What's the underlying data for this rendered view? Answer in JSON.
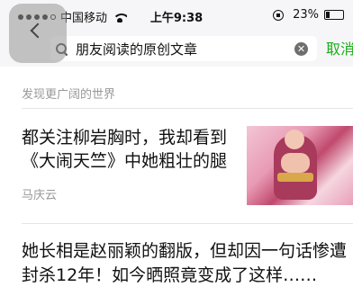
{
  "status_bar": {
    "carrier": "中国移动",
    "time": "上午9:38",
    "battery_percent": "23%",
    "battery_level": 0.23,
    "signal_bars": 4
  },
  "search": {
    "query": "朋友阅读的原创文章",
    "cancel_label": "取消"
  },
  "section": {
    "label": "发现更广阔的世界"
  },
  "articles": [
    {
      "title_lines": [
        "都关注柳岩胸时，我却看到",
        "《大闹天竺》中她粗壮的腿"
      ],
      "source": "马庆云",
      "thumbnail": "thumbnail-image"
    },
    {
      "title_lines": [
        "她长相是赵丽颖的翻版，但却因一句话惨遭",
        "封杀12年！如今晒照竟变成了这样……"
      ]
    }
  ],
  "colors": {
    "accent": "#1aad19",
    "muted_text": "#999999",
    "bar_background": "#f6f6f8"
  },
  "icons": [
    "wifi-icon",
    "rotation-lock-icon",
    "battery-icon",
    "back-icon",
    "search-icon",
    "clear-icon"
  ]
}
